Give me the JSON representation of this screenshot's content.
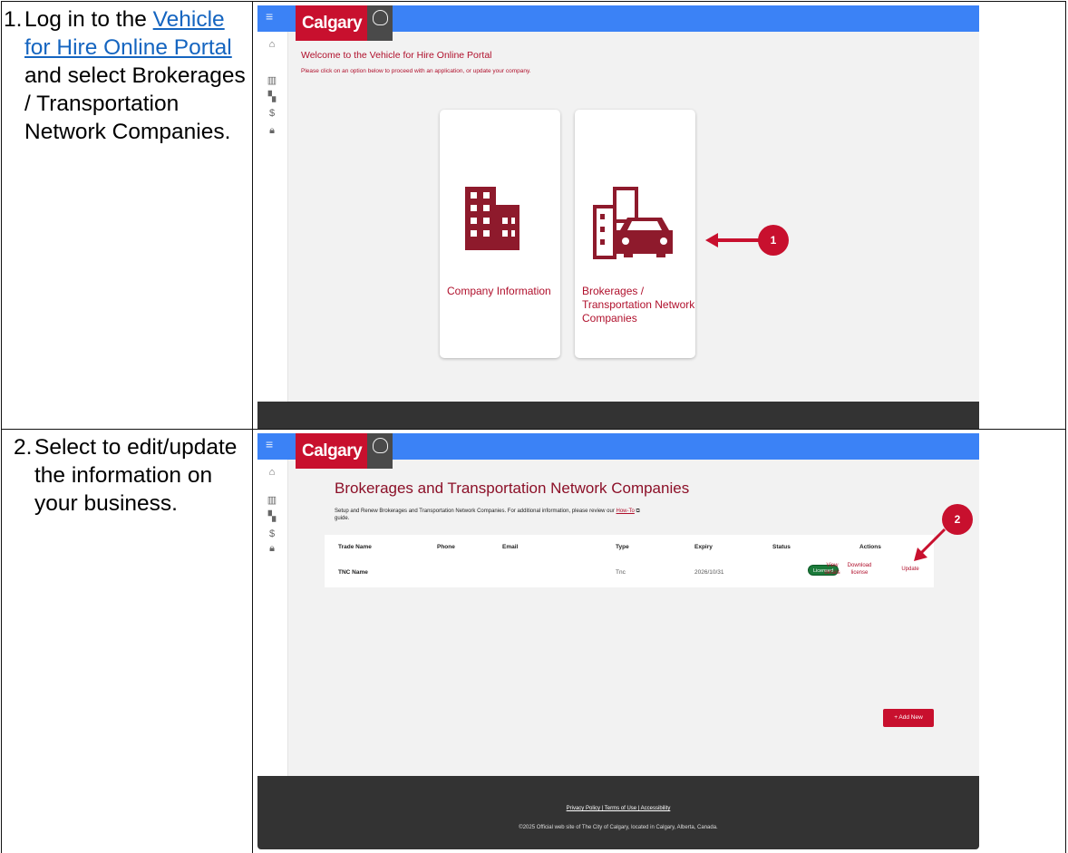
{
  "step1": {
    "number": "1.",
    "text_before_link": "Log in to the",
    "link_text": "Vehicle for Hire Online Portal",
    "text_after_link": "and select Brokerages / Transportation Network Companies."
  },
  "step2": {
    "number": "2.",
    "text": "Select to edit/update the information on your business."
  },
  "portal": {
    "logo_text": "Calgary",
    "welcome_title": "Welcome to the Vehicle for Hire Online Portal",
    "welcome_subtitle": "Please click on an option below to proceed with an application, or update your company.",
    "cards": [
      {
        "label": "Company Information",
        "icon": "building-icon"
      },
      {
        "label": "Brokerages / Transportation Network Companies",
        "icon": "building-car-icon"
      }
    ],
    "callout_1": "1"
  },
  "brokerages": {
    "page_title": "Brokerages and Transportation Network Companies",
    "description_prefix": "Setup and Renew Brokerages and Transportation Network Companies. For additional information, please review our",
    "howto_link": "How-To",
    "description_suffix": "guide.",
    "columns": [
      "Trade Name",
      "Phone",
      "Email",
      "Type",
      "Expiry",
      "Status",
      "Actions"
    ],
    "row": {
      "trade_name": "TNC Name",
      "phone": "",
      "email": "",
      "type": "Tnc",
      "expiry": "2026/10/31",
      "status": "Licensed",
      "action_view": "View details",
      "action_download": "Download license",
      "action_update": "Update"
    },
    "add_button": "+ Add New",
    "callout_2": "2",
    "footer_links": "Privacy Policy | Terms of Use | Accessibility",
    "footer_copy": "©2025 Official web site of The City of Calgary, located in Calgary, Alberta, Canada."
  },
  "colors": {
    "brand_red": "#c8102e",
    "header_blue": "#3b82f6",
    "footer_dark": "#333333",
    "link_blue": "#1565c0",
    "status_green": "#1b7a3a"
  }
}
